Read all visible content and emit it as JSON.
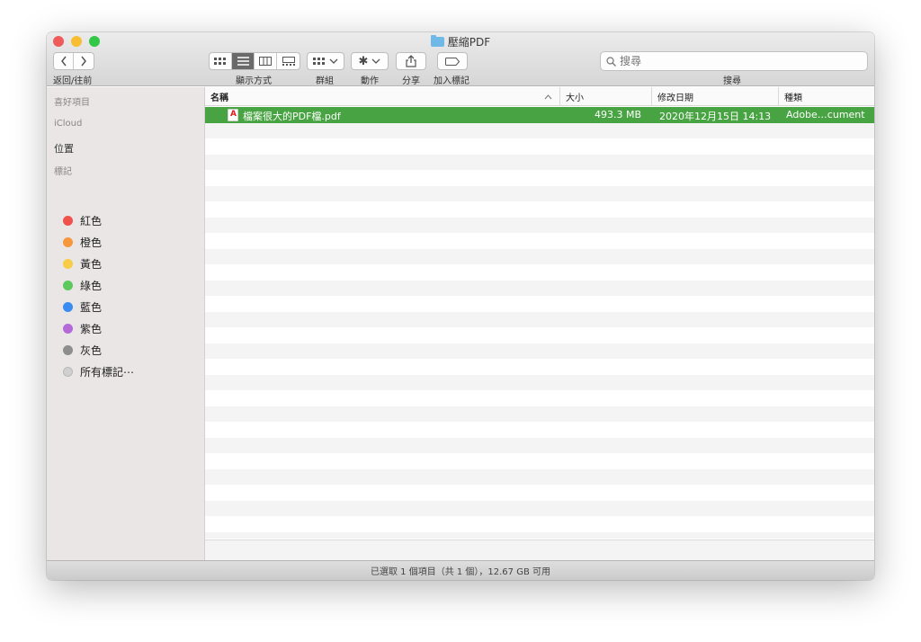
{
  "window": {
    "title": "壓縮PDF",
    "traffic_lights": {
      "close": "#ef5b5a",
      "minimize": "#f8bd30",
      "zoom": "#33c748"
    }
  },
  "toolbar": {
    "back_icon": "chevron-left-icon",
    "forward_icon": "chevron-right-icon",
    "nav_label": "返回/往前",
    "view_label": "顯示方式",
    "group_label": "群組",
    "action_label": "動作",
    "share_label": "分享",
    "tag_label": "加入標記",
    "search_placeholder": "搜尋",
    "search_label": "搜尋"
  },
  "sidebar": {
    "favorites": "喜好項目",
    "icloud": "iCloud",
    "locations": "位置",
    "tags_header": "標記",
    "tags": [
      {
        "label": "紅色",
        "color": "#f0524b"
      },
      {
        "label": "橙色",
        "color": "#f7973d"
      },
      {
        "label": "黃色",
        "color": "#f7cc47"
      },
      {
        "label": "綠色",
        "color": "#5cc95c"
      },
      {
        "label": "藍色",
        "color": "#3b8cf0"
      },
      {
        "label": "紫色",
        "color": "#b36ad8"
      },
      {
        "label": "灰色",
        "color": "#8e8e8e"
      },
      {
        "label": "所有標記⋯",
        "color": "#d0d0d0"
      }
    ]
  },
  "columns": {
    "name": "名稱",
    "size": "大小",
    "modified": "修改日期",
    "kind": "種類"
  },
  "files": [
    {
      "name": "檔案很大的PDF檔.pdf",
      "size": "493.3 MB",
      "modified": "2020年12月15日 14:13",
      "kind": "Adobe…cument",
      "selected": true
    }
  ],
  "status": "已選取 1 個項目（共 1 個），12.67 GB 可用",
  "selection_color": "#48a342"
}
